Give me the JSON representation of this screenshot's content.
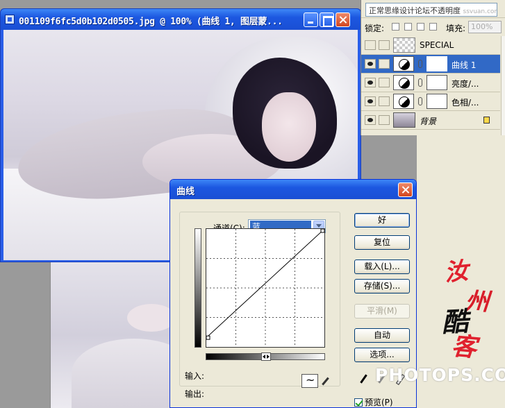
{
  "document_window": {
    "title": "001109f6fc5d0b102d0505.jpg @ 100% (曲线 1, 图层蒙...",
    "buttons": {
      "minimize": "minimize",
      "maximize": "maximize",
      "close": "close"
    }
  },
  "layers_panel": {
    "blend_mode": "正常",
    "overlay_text": "思缘设计论坛",
    "opacity_label": "不透明度",
    "watermark": "ssvuan.com",
    "lock_label": "锁定:",
    "fill_label": "填充:",
    "fill_value": "100%",
    "layers": [
      {
        "name": "SPECIAL",
        "visible": false,
        "selected": false,
        "type": "pattern"
      },
      {
        "name": "曲线 1",
        "visible": true,
        "selected": true,
        "type": "adjustment"
      },
      {
        "name": "亮度/...",
        "visible": true,
        "selected": false,
        "type": "adjustment"
      },
      {
        "name": "色相/...",
        "visible": true,
        "selected": false,
        "type": "adjustment"
      },
      {
        "name": "背景",
        "visible": true,
        "selected": false,
        "type": "background",
        "locked": true
      }
    ]
  },
  "curves_dialog": {
    "title": "曲线",
    "channel_label": "通道(C):",
    "channel_value": "蓝",
    "input_label": "输入:",
    "output_label": "输出:",
    "buttons": {
      "ok": "好",
      "reset": "复位",
      "load": "载入(L)...",
      "save": "存储(S)...",
      "smooth": "平滑(M)",
      "auto": "自动",
      "options": "选项..."
    },
    "preview_label": "预览(P)",
    "preview_checked": true,
    "curve_points": [
      [
        0,
        20
      ],
      [
        255,
        255
      ]
    ]
  },
  "signature": {
    "chars": [
      "汝",
      "州",
      "酷",
      "客"
    ]
  },
  "watermark": "PHOTOPS.COM"
}
